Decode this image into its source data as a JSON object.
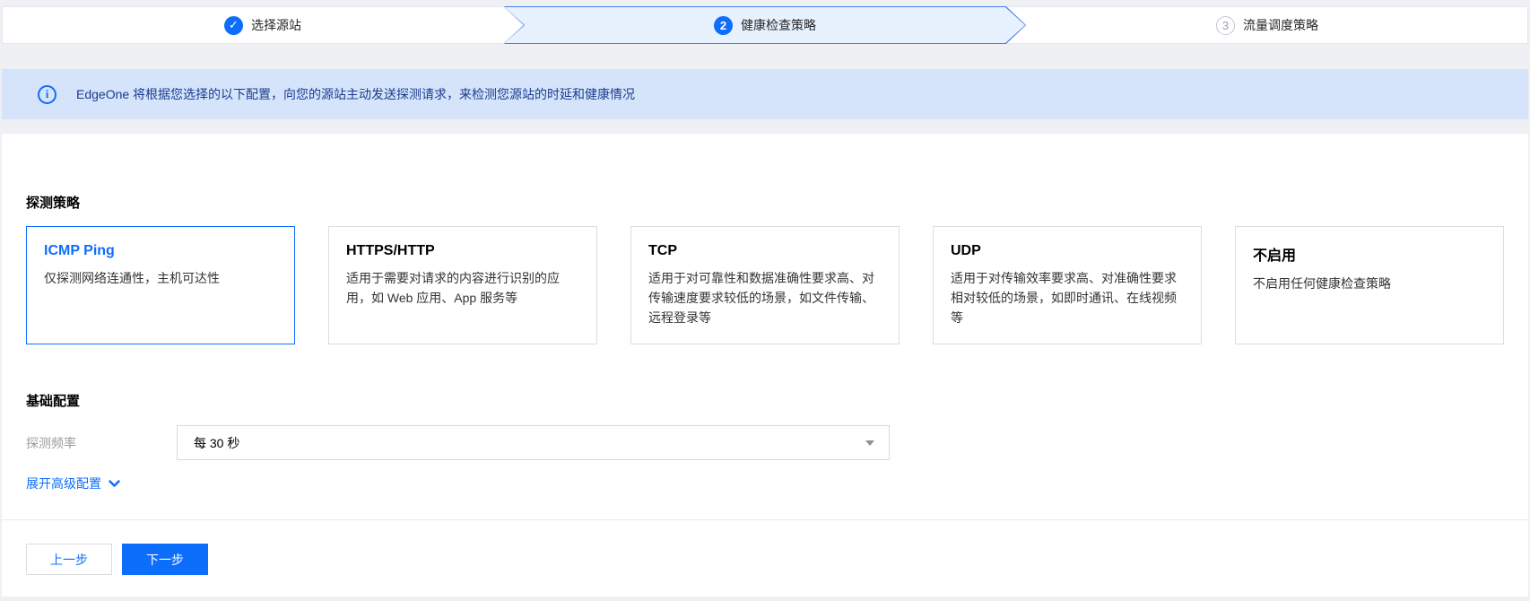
{
  "colors": {
    "accent": "#0d6efc",
    "step-active-bg": "#e8f1fe",
    "step-active-border": "#4181f0",
    "banner-bg": "#d5e4fa",
    "banner-text": "#1a3c8f",
    "page-bg": "#eef0f3"
  },
  "icons": {
    "check": "✓",
    "info": "i"
  },
  "steps": {
    "items": [
      {
        "label": "选择源站",
        "status": "done"
      },
      {
        "number": "2",
        "label": "健康检查策略",
        "status": "active"
      },
      {
        "number": "3",
        "label": "流量调度策略",
        "status": "pending"
      }
    ]
  },
  "banner": {
    "text": "EdgeOne 将根据您选择的以下配置，向您的源站主动发送探测请求，来检测您源站的时延和健康情况"
  },
  "probe": {
    "title": "探测策略",
    "options": [
      {
        "title": "ICMP Ping",
        "desc": "仅探测网络连通性，主机可达性",
        "selected": true
      },
      {
        "title": "HTTPS/HTTP",
        "desc": "适用于需要对请求的内容进行识别的应用，如 Web 应用、App 服务等",
        "selected": false
      },
      {
        "title": "TCP",
        "desc": "适用于对可靠性和数据准确性要求高、对传输速度要求较低的场景，如文件传输、远程登录等",
        "selected": false
      },
      {
        "title": "UDP",
        "desc": "适用于对传输效率要求高、对准确性要求相对较低的场景，如即时通讯、在线视频等",
        "selected": false
      },
      {
        "title": "不启用",
        "desc": "不启用任何健康检查策略",
        "selected": false
      }
    ]
  },
  "basic": {
    "title": "基础配置",
    "frequency_label": "探测频率",
    "frequency_value": "每 30 秒",
    "advanced_toggle": "展开高级配置"
  },
  "footer": {
    "prev_label": "上一步",
    "next_label": "下一步"
  }
}
